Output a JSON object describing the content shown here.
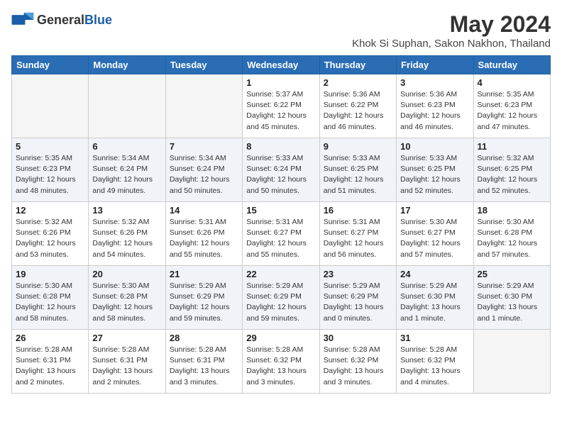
{
  "header": {
    "logo_general": "General",
    "logo_blue": "Blue",
    "month_title": "May 2024",
    "location": "Khok Si Suphan, Sakon Nakhon, Thailand"
  },
  "days_of_week": [
    "Sunday",
    "Monday",
    "Tuesday",
    "Wednesday",
    "Thursday",
    "Friday",
    "Saturday"
  ],
  "weeks": [
    [
      {
        "day": "",
        "info": ""
      },
      {
        "day": "",
        "info": ""
      },
      {
        "day": "",
        "info": ""
      },
      {
        "day": "1",
        "info": "Sunrise: 5:37 AM\nSunset: 6:22 PM\nDaylight: 12 hours\nand 45 minutes."
      },
      {
        "day": "2",
        "info": "Sunrise: 5:36 AM\nSunset: 6:22 PM\nDaylight: 12 hours\nand 46 minutes."
      },
      {
        "day": "3",
        "info": "Sunrise: 5:36 AM\nSunset: 6:23 PM\nDaylight: 12 hours\nand 46 minutes."
      },
      {
        "day": "4",
        "info": "Sunrise: 5:35 AM\nSunset: 6:23 PM\nDaylight: 12 hours\nand 47 minutes."
      }
    ],
    [
      {
        "day": "5",
        "info": "Sunrise: 5:35 AM\nSunset: 6:23 PM\nDaylight: 12 hours\nand 48 minutes."
      },
      {
        "day": "6",
        "info": "Sunrise: 5:34 AM\nSunset: 6:24 PM\nDaylight: 12 hours\nand 49 minutes."
      },
      {
        "day": "7",
        "info": "Sunrise: 5:34 AM\nSunset: 6:24 PM\nDaylight: 12 hours\nand 50 minutes."
      },
      {
        "day": "8",
        "info": "Sunrise: 5:33 AM\nSunset: 6:24 PM\nDaylight: 12 hours\nand 50 minutes."
      },
      {
        "day": "9",
        "info": "Sunrise: 5:33 AM\nSunset: 6:25 PM\nDaylight: 12 hours\nand 51 minutes."
      },
      {
        "day": "10",
        "info": "Sunrise: 5:33 AM\nSunset: 6:25 PM\nDaylight: 12 hours\nand 52 minutes."
      },
      {
        "day": "11",
        "info": "Sunrise: 5:32 AM\nSunset: 6:25 PM\nDaylight: 12 hours\nand 52 minutes."
      }
    ],
    [
      {
        "day": "12",
        "info": "Sunrise: 5:32 AM\nSunset: 6:26 PM\nDaylight: 12 hours\nand 53 minutes."
      },
      {
        "day": "13",
        "info": "Sunrise: 5:32 AM\nSunset: 6:26 PM\nDaylight: 12 hours\nand 54 minutes."
      },
      {
        "day": "14",
        "info": "Sunrise: 5:31 AM\nSunset: 6:26 PM\nDaylight: 12 hours\nand 55 minutes."
      },
      {
        "day": "15",
        "info": "Sunrise: 5:31 AM\nSunset: 6:27 PM\nDaylight: 12 hours\nand 55 minutes."
      },
      {
        "day": "16",
        "info": "Sunrise: 5:31 AM\nSunset: 6:27 PM\nDaylight: 12 hours\nand 56 minutes."
      },
      {
        "day": "17",
        "info": "Sunrise: 5:30 AM\nSunset: 6:27 PM\nDaylight: 12 hours\nand 57 minutes."
      },
      {
        "day": "18",
        "info": "Sunrise: 5:30 AM\nSunset: 6:28 PM\nDaylight: 12 hours\nand 57 minutes."
      }
    ],
    [
      {
        "day": "19",
        "info": "Sunrise: 5:30 AM\nSunset: 6:28 PM\nDaylight: 12 hours\nand 58 minutes."
      },
      {
        "day": "20",
        "info": "Sunrise: 5:30 AM\nSunset: 6:28 PM\nDaylight: 12 hours\nand 58 minutes."
      },
      {
        "day": "21",
        "info": "Sunrise: 5:29 AM\nSunset: 6:29 PM\nDaylight: 12 hours\nand 59 minutes."
      },
      {
        "day": "22",
        "info": "Sunrise: 5:29 AM\nSunset: 6:29 PM\nDaylight: 12 hours\nand 59 minutes."
      },
      {
        "day": "23",
        "info": "Sunrise: 5:29 AM\nSunset: 6:29 PM\nDaylight: 13 hours\nand 0 minutes."
      },
      {
        "day": "24",
        "info": "Sunrise: 5:29 AM\nSunset: 6:30 PM\nDaylight: 13 hours\nand 1 minute."
      },
      {
        "day": "25",
        "info": "Sunrise: 5:29 AM\nSunset: 6:30 PM\nDaylight: 13 hours\nand 1 minute."
      }
    ],
    [
      {
        "day": "26",
        "info": "Sunrise: 5:28 AM\nSunset: 6:31 PM\nDaylight: 13 hours\nand 2 minutes."
      },
      {
        "day": "27",
        "info": "Sunrise: 5:28 AM\nSunset: 6:31 PM\nDaylight: 13 hours\nand 2 minutes."
      },
      {
        "day": "28",
        "info": "Sunrise: 5:28 AM\nSunset: 6:31 PM\nDaylight: 13 hours\nand 3 minutes."
      },
      {
        "day": "29",
        "info": "Sunrise: 5:28 AM\nSunset: 6:32 PM\nDaylight: 13 hours\nand 3 minutes."
      },
      {
        "day": "30",
        "info": "Sunrise: 5:28 AM\nSunset: 6:32 PM\nDaylight: 13 hours\nand 3 minutes."
      },
      {
        "day": "31",
        "info": "Sunrise: 5:28 AM\nSunset: 6:32 PM\nDaylight: 13 hours\nand 4 minutes."
      },
      {
        "day": "",
        "info": ""
      }
    ]
  ]
}
